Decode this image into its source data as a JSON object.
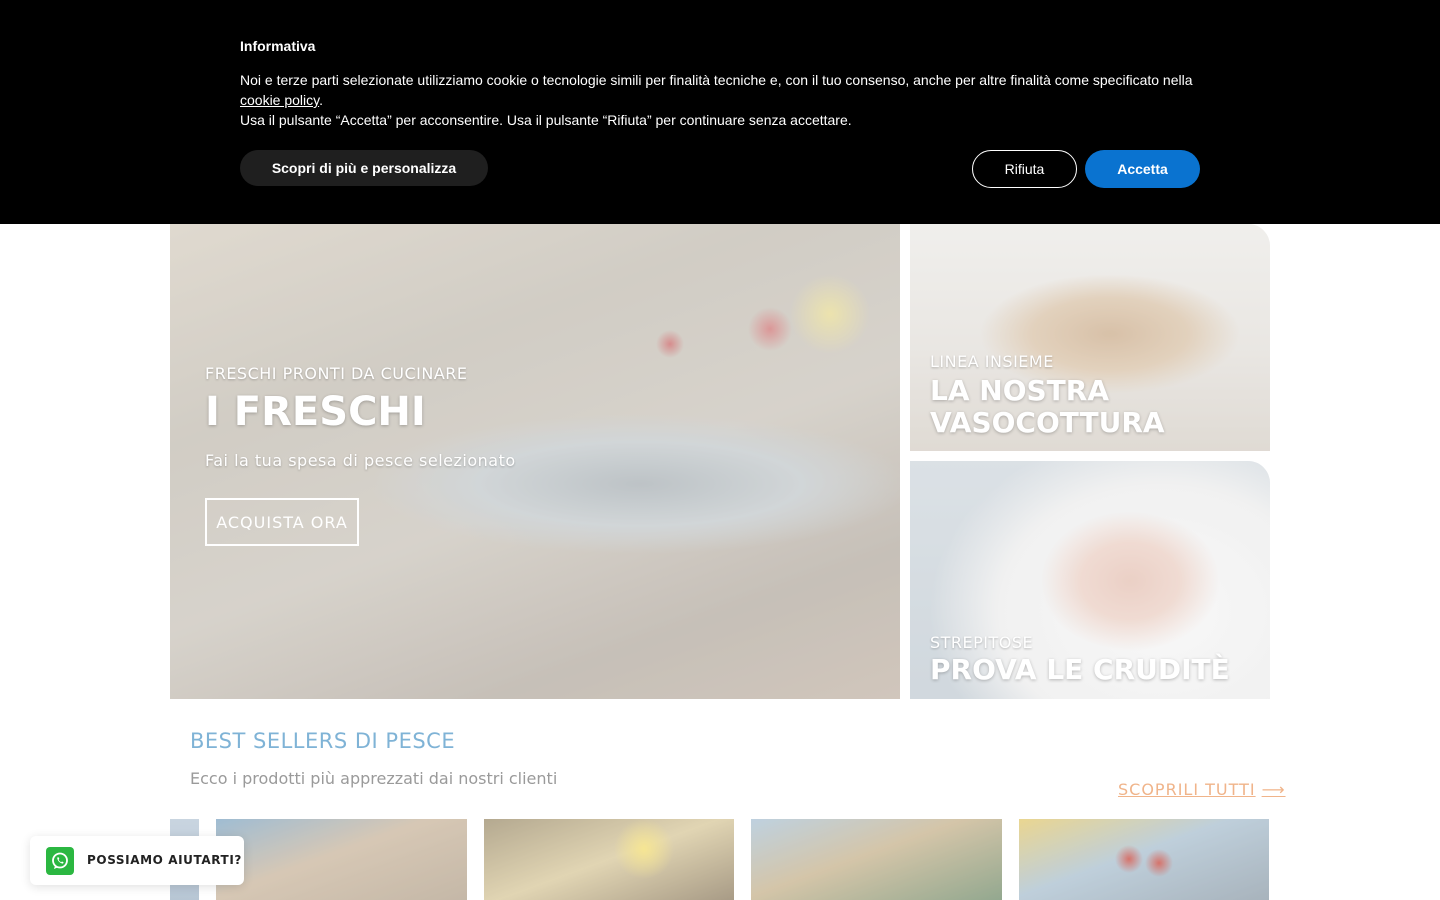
{
  "cookie_banner": {
    "title": "Informativa",
    "text_before_link": "Noi e terze parti selezionate utilizziamo cookie o tecnologie simili per finalità tecniche e, con il tuo consenso, anche per altre finalità come specificato nella",
    "link_label": "cookie policy",
    "text_after_link": ".",
    "text_line2": "Usa il pulsante “Accetta” per acconsentire. Usa il pulsante “Rifiuta” per continuare senza accettare.",
    "customize_label": "Scopri di più e personalizza",
    "reject_label": "Rifiuta",
    "accept_label": "Accetta",
    "accept_color": "#0a73d0"
  },
  "hero": {
    "main": {
      "eyebrow": "FRESCHI PRONTI DA CUCINARE",
      "title": "I FRESCHI",
      "subtitle": "Fai la tua spesa di pesce selezionato",
      "button_label": "ACQUISTA ORA"
    },
    "side_top": {
      "eyebrow": "LINEA INSIEME",
      "title_line1": "LA NOSTRA",
      "title_line2": "VASOCOTTURA"
    },
    "side_bottom": {
      "eyebrow": "STREPITOSE",
      "title": "PROVA LE CRUDITÈ"
    }
  },
  "best_sellers": {
    "title": "BEST SELLERS DI PESCE",
    "subtitle": "Ecco i prodotti più apprezzati dai nostri clienti",
    "link_label": "SCOPRILI TUTTI",
    "link_arrow": "⟶",
    "title_color": "#7fb3d6",
    "link_color": "#f0b48a"
  },
  "chat_widget": {
    "label": "POSSIAMO AIUTARTI?",
    "icon": "whatsapp-icon",
    "icon_color": "#2bb741"
  }
}
